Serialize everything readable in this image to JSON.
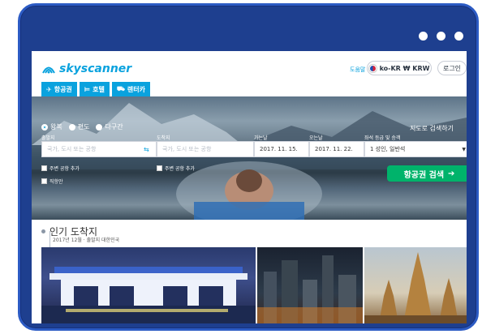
{
  "brand": {
    "name": "skyscanner",
    "color": "#0aa2de"
  },
  "header": {
    "help_label": "도움말",
    "locale_label": "ko-KR ₩ KRW",
    "login_label": "로그인"
  },
  "tabs": [
    {
      "label": "항공권",
      "icon": "plane-icon"
    },
    {
      "label": "호텔",
      "icon": "bed-icon"
    },
    {
      "label": "렌터카",
      "icon": "car-icon"
    }
  ],
  "search": {
    "trip_types": [
      "왕복",
      "편도",
      "다구간"
    ],
    "selected_trip": "왕복",
    "map_link": "지도로 검색하기",
    "origin": {
      "label": "출발지",
      "placeholder": "국가, 도시 또는 공항"
    },
    "destination": {
      "label": "도착지",
      "placeholder": "국가, 도시 또는 공항"
    },
    "depart": {
      "label": "가는날",
      "value": "2017. 11. 15."
    },
    "return": {
      "label": "오는날",
      "value": "2017. 11. 22."
    },
    "cabin": {
      "label": "좌석 등급 및 승객",
      "value": "1 성인, 일반석"
    },
    "nearby_origin": "주변 공항 추가",
    "nearby_dest": "주변 공항 추가",
    "direct_only": "직항만",
    "submit_label": "항공권 검색",
    "submit_color": "#00b36b"
  },
  "popular": {
    "title": "인기 도착지",
    "subtitle": "2017년 12월 · 출발지 대한민국"
  }
}
